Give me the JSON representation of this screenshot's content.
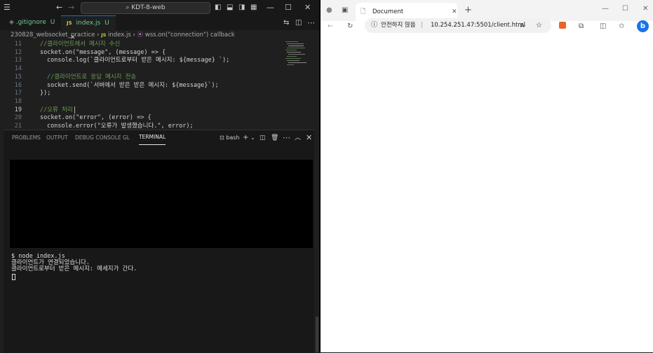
{
  "vscode": {
    "command_center": "KDT-8-web",
    "tabs": [
      {
        "icon": "◈",
        "name": ".gitignore",
        "status": "U"
      },
      {
        "icon": "JS",
        "name": "index.js",
        "status": "U",
        "close": "✕"
      }
    ],
    "breadcrumb": {
      "folder": "230828_websocket_practice",
      "sep": "›",
      "file_icon": "JS",
      "file": "index.js",
      "symbol": "wss.on(\"connection\") callback"
    },
    "code_lines": [
      {
        "num": "11",
        "text": "//클라이언트에서 메시지 수신",
        "type": "comment",
        "indent": 0
      },
      {
        "num": "12",
        "text": "socket.on(\"message\", (message) => {",
        "type": "code",
        "indent": 0
      },
      {
        "num": "13",
        "text": "console.log(`클라이언트로부터 받은 메시지: ${message} `);",
        "type": "code",
        "indent": 1
      },
      {
        "num": "14",
        "text": "",
        "type": "code",
        "indent": 0
      },
      {
        "num": "15",
        "text": "//클라이언트로 응답 메시지 전송",
        "type": "comment",
        "indent": 1
      },
      {
        "num": "16",
        "text": "socket.send(`서버에서 받은 받은 메시지: ${message}`);",
        "type": "code",
        "indent": 1
      },
      {
        "num": "17",
        "text": "});",
        "type": "code",
        "indent": 0
      },
      {
        "num": "18",
        "text": "",
        "type": "code",
        "indent": 0
      },
      {
        "num": "19",
        "text": "//오류 처리",
        "type": "comment",
        "indent": 0
      },
      {
        "num": "20",
        "text": "socket.on(\"error\", (error) => {",
        "type": "code",
        "indent": 0
      },
      {
        "num": "21",
        "text": "console.error(\"오류가 발생했습니다.\", error);",
        "type": "code",
        "indent": 1
      }
    ],
    "panel_tabs": [
      "PROBLEMS",
      "OUTPUT",
      "DEBUG CONSOLE",
      "GL",
      "TERMINAL"
    ],
    "terminal_shell": "bash",
    "terminal_lines": [
      "$ node index.js",
      "클라이언트가 연결되었습니다.",
      "클라이언트로부터 받은 메시지: 메세지가 간다."
    ]
  },
  "browser": {
    "tab_title": "Document",
    "security_label": "안전하지 않음",
    "url": "10.254.251.47:5501/client.html"
  },
  "colors": {
    "comment": "#6a9955",
    "accent": "#0078d4",
    "string": "#ce9178"
  }
}
